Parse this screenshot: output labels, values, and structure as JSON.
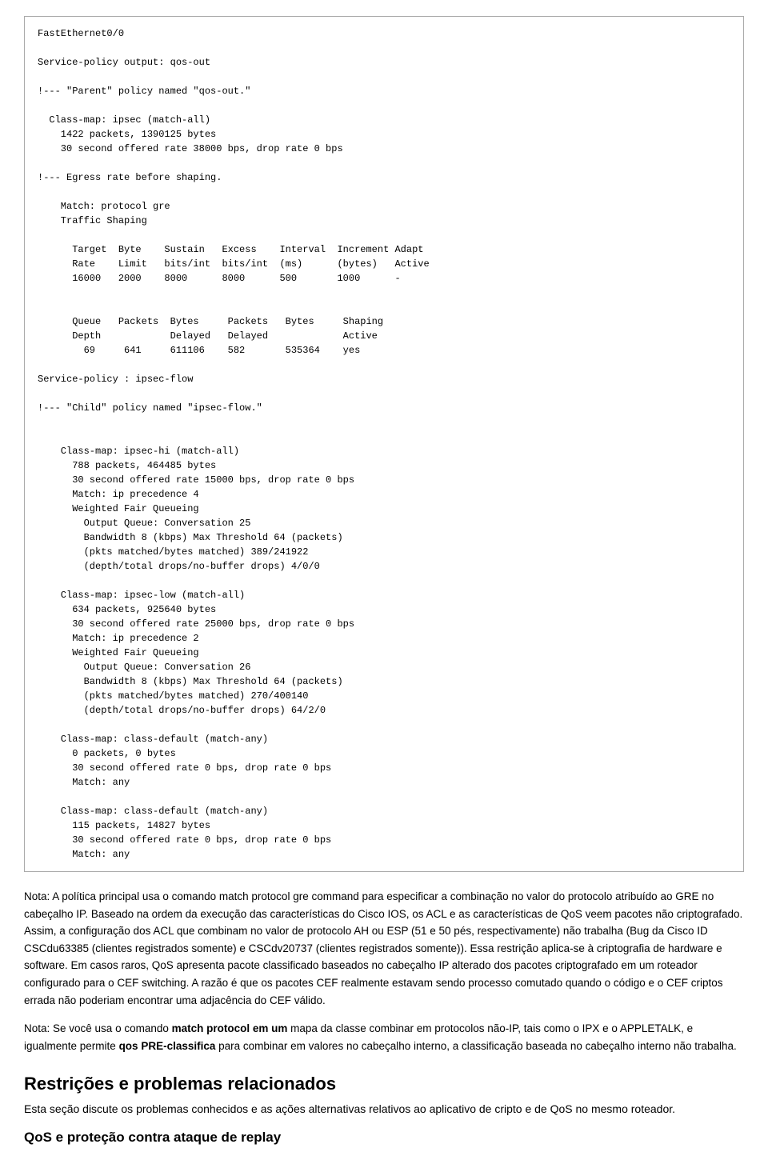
{
  "code": {
    "content": "FastEthernet0/0\n\nService-policy output: qos-out\n\n!--- \"Parent\" policy named \"qos-out.\"\n\n  Class-map: ipsec (match-all)\n    1422 packets, 1390125 bytes\n    30 second offered rate 38000 bps, drop rate 0 bps\n\n!--- Egress rate before shaping.\n\n    Match: protocol gre\n    Traffic Shaping\n\n      Target  Byte    Sustain   Excess    Interval  Increment Adapt\n      Rate    Limit   bits/int  bits/int  (ms)      (bytes)   Active\n      16000   2000    8000      8000      500       1000      -\n\n\n      Queue   Packets  Bytes     Packets   Bytes     Shaping\n      Depth            Delayed   Delayed             Active\n        69     641     611106    582       535364    yes\n\nService-policy : ipsec-flow\n\n!--- \"Child\" policy named \"ipsec-flow.\"\n\n\n    Class-map: ipsec-hi (match-all)\n      788 packets, 464485 bytes\n      30 second offered rate 15000 bps, drop rate 0 bps\n      Match: ip precedence 4\n      Weighted Fair Queueing\n        Output Queue: Conversation 25\n        Bandwidth 8 (kbps) Max Threshold 64 (packets)\n        (pkts matched/bytes matched) 389/241922\n        (depth/total drops/no-buffer drops) 4/0/0\n\n    Class-map: ipsec-low (match-all)\n      634 packets, 925640 bytes\n      30 second offered rate 25000 bps, drop rate 0 bps\n      Match: ip precedence 2\n      Weighted Fair Queueing\n        Output Queue: Conversation 26\n        Bandwidth 8 (kbps) Max Threshold 64 (packets)\n        (pkts matched/bytes matched) 270/400140\n        (depth/total drops/no-buffer drops) 64/2/0\n\n    Class-map: class-default (match-any)\n      0 packets, 0 bytes\n      30 second offered rate 0 bps, drop rate 0 bps\n      Match: any\n\n    Class-map: class-default (match-any)\n      115 packets, 14827 bytes\n      30 second offered rate 0 bps, drop rate 0 bps\n      Match: any"
  },
  "notes": {
    "note1": "Nota: A política principal usa o comando match protocol gre command para especificar a combinação no valor do protocolo atribuído ao GRE no cabeçalho IP. Baseado na ordem da execução das características do Cisco IOS, os ACL e as características de QoS veem pacotes não criptografado. Assim, a configuração dos ACL que combinam no valor de protocolo AH ou ESP (51 e 50 pés, respectivamente) não trabalha (Bug da Cisco ID CSCdu63385 (clientes registrados somente) e CSCdv20737 (clientes registrados somente)). Essa restrição aplica-se à criptografia de hardware e software. Em casos raros, QoS apresenta pacote classificado baseados no cabeçalho IP alterado dos pacotes criptografado em um roteador configurado para o CEF switching. A razão é que os pacotes CEF realmente estavam sendo processo comutado quando o código e o CEF criptos errada não poderiam encontrar uma adjacência do CEF válido.",
    "note2": "Nota: Se você usa o comando match protocol em um mapa da classe combinar em protocolos não-IP, tais como o IPX e o APPLETALK, e igualmente permite qos PRE-classifica para combinar em valores no cabeçalho interno, a classificação baseada no cabeçalho interno não trabalha.",
    "note2_bold_parts": {
      "match_protocol": "match protocol em um",
      "qos_pre": "qos PRE-classifica"
    }
  },
  "section_heading": "Restrições e problemas relacionados",
  "section_text": "Esta seção discute os problemas conhecidos e as ações alternativas relativos ao aplicativo de cripto e de QoS no mesmo roteador.",
  "subsection_heading": "QoS e proteção contra ataque de replay"
}
